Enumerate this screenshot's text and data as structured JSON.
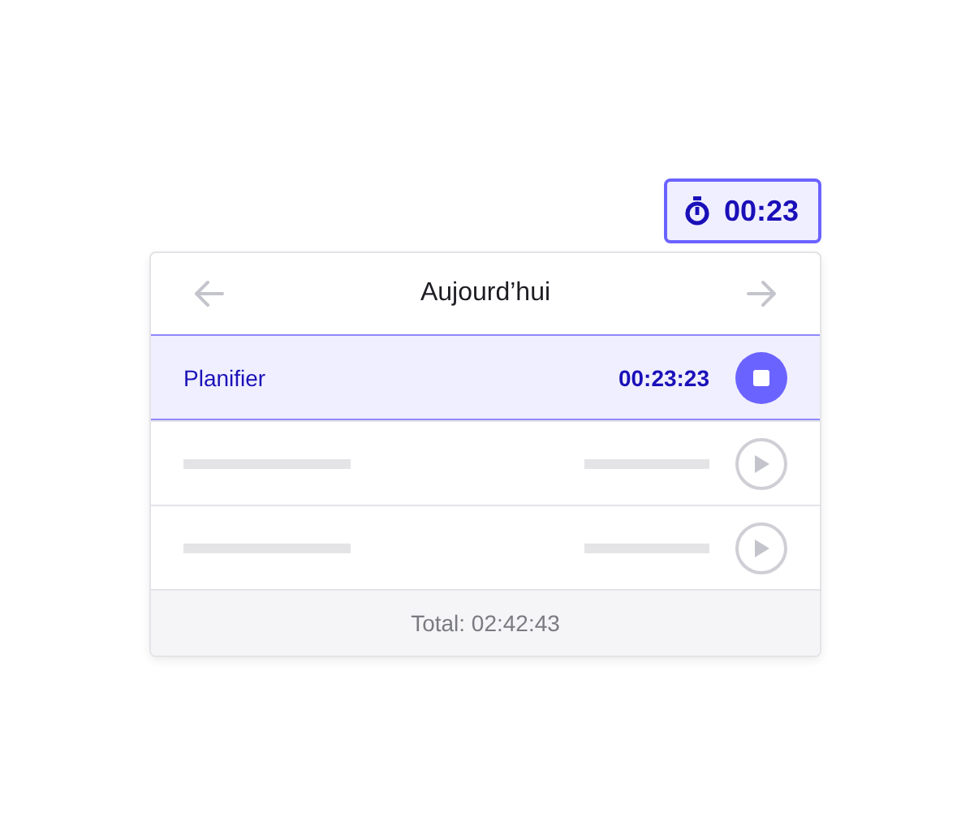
{
  "timer_badge": {
    "time": "00:23"
  },
  "card": {
    "title": "Aujourd’hui",
    "entries": [
      {
        "kind": "task",
        "label": "Planifier",
        "duration": "00:23:23",
        "running": true
      },
      {
        "kind": "placeholder",
        "running": false
      },
      {
        "kind": "placeholder",
        "running": false
      }
    ],
    "total": "Total: 02:42:43"
  }
}
